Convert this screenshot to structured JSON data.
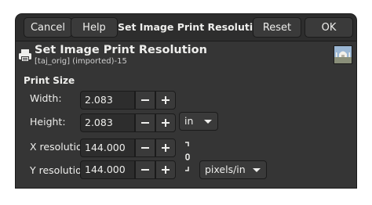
{
  "header": {
    "cancel_label": "Cancel",
    "help_label": "Help",
    "title": "Set Image Print Resolution",
    "reset_label": "Reset",
    "ok_label": "OK"
  },
  "dialog": {
    "title": "Set Image Print Resolution",
    "subtitle": "[taj_orig] (imported)-15"
  },
  "print_size": {
    "section_label": "Print Size",
    "width_label": "Width:",
    "width_value": "2.083",
    "height_label": "Height:",
    "height_value": "2.083",
    "size_unit": "in",
    "x_res_label": "X resolution:",
    "x_res_value": "144.000",
    "y_res_label": "Y resolution:",
    "y_res_value": "144.000",
    "res_unit": "pixels/in"
  },
  "icons": {
    "printer": "printer-icon",
    "minus": "minus-icon",
    "plus": "plus-icon",
    "chain": "chain-link-icon",
    "dropdown": "chevron-down-icon"
  },
  "colors": {
    "dialog_bg": "#353535",
    "headerbar_bg": "#2d2d2d",
    "text": "#eeeeec"
  }
}
